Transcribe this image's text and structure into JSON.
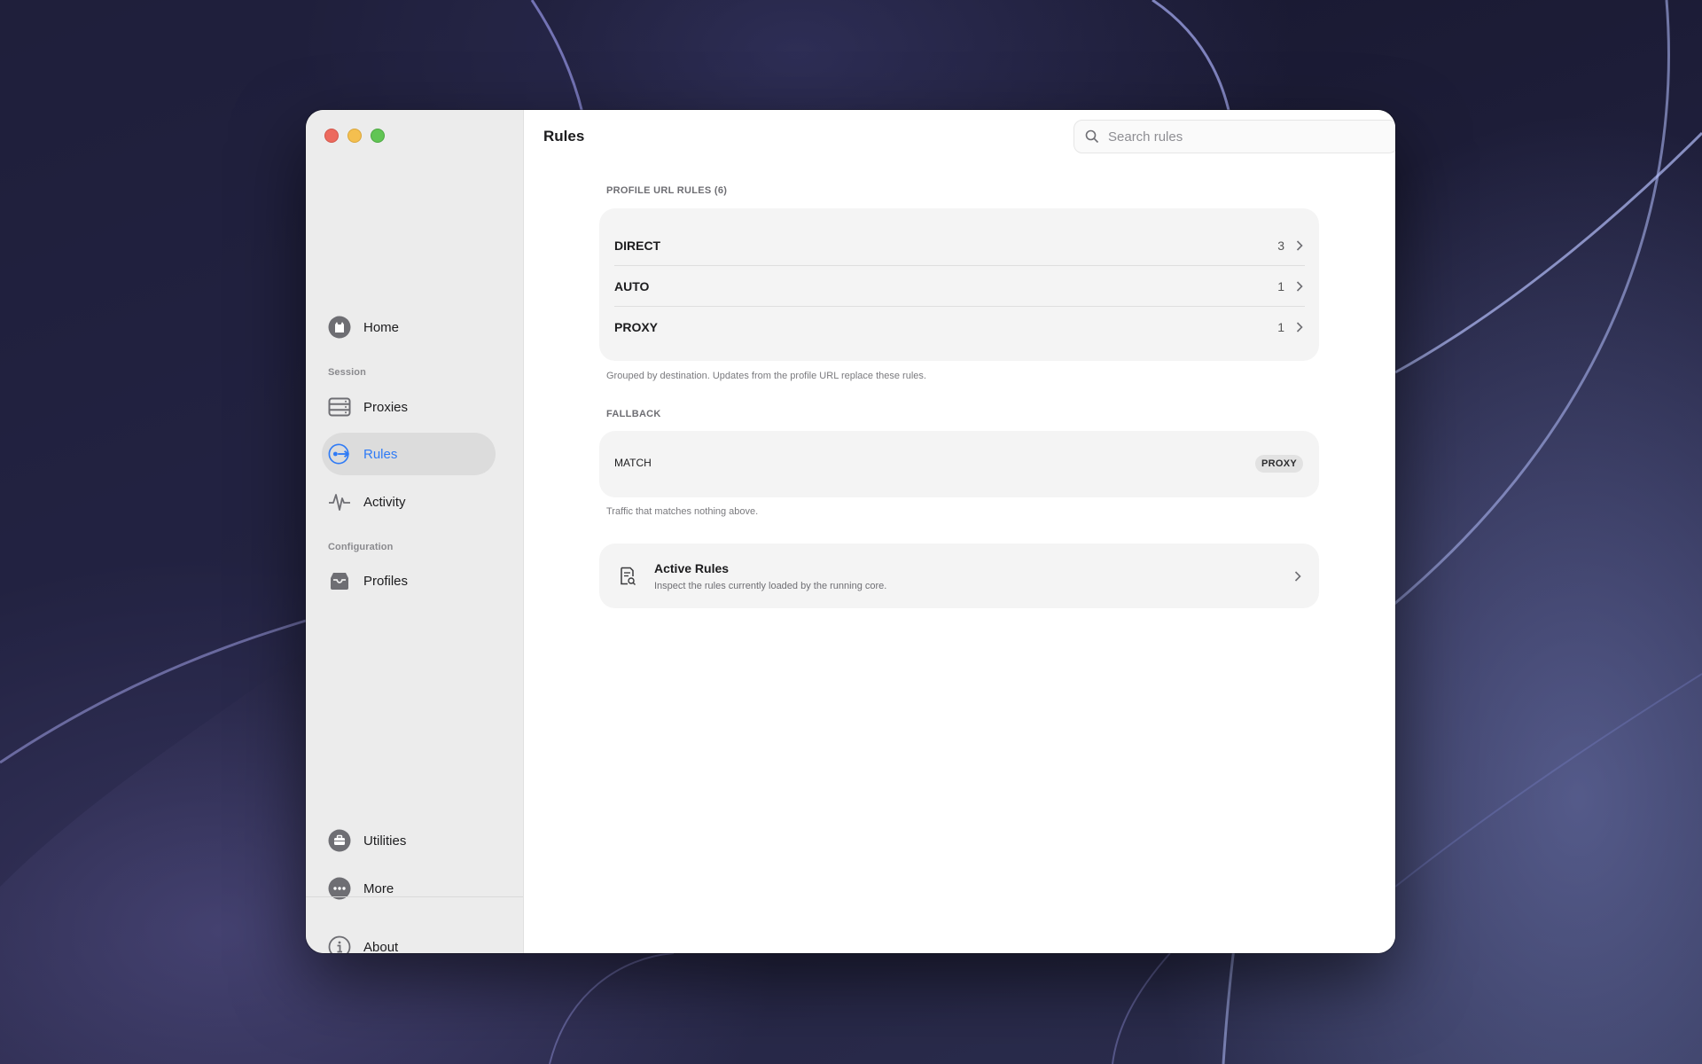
{
  "window": {
    "title": "Rules"
  },
  "search": {
    "placeholder": "Search rules",
    "value": ""
  },
  "sidebar": {
    "home_label": "Home",
    "session_label": "Session",
    "proxies_label": "Proxies",
    "rules_label": "Rules",
    "activity_label": "Activity",
    "configuration_label": "Configuration",
    "profiles_label": "Profiles",
    "utilities_label": "Utilities",
    "more_label": "More",
    "about_label": "About",
    "active_item": "Rules"
  },
  "profile_rules": {
    "header": "PROFILE URL RULES (6)",
    "rows": [
      {
        "name": "DIRECT",
        "count": "3"
      },
      {
        "name": "AUTO",
        "count": "1"
      },
      {
        "name": "PROXY",
        "count": "1"
      }
    ],
    "footnote": "Grouped by destination. Updates from the profile URL replace these rules."
  },
  "fallback": {
    "header": "FALLBACK",
    "match_label": "MATCH",
    "badge": "PROXY",
    "footnote": "Traffic that matches nothing above."
  },
  "active_rules": {
    "title": "Active Rules",
    "subtitle": "Inspect the rules currently loaded by the running core."
  },
  "colors": {
    "accent": "#2f7bf6",
    "sidebar_bg": "#ececec",
    "card_bg": "#f4f4f4",
    "close": "#ec6a5e",
    "minimize": "#f4bf4f",
    "zoom": "#61c554"
  }
}
